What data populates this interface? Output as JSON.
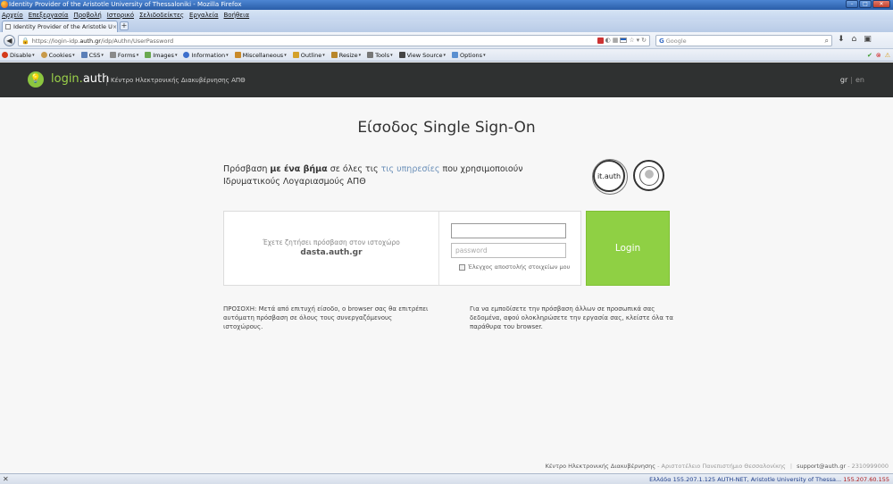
{
  "window": {
    "title": "Identity Provider of the Aristotle University of Thessaloniki - Mozilla Firefox",
    "controls": {
      "minimize": "–",
      "maximize": "□",
      "close": "✕"
    }
  },
  "menubar": {
    "items": [
      "Αρχείο",
      "Επεξεργασία",
      "Προβολή",
      "Ιστορικό",
      "Σελιδοδείκτες",
      "Εργαλεία",
      "Βοήθεια"
    ]
  },
  "tabs": [
    {
      "label": "Identity Provider of the Aristotle Universi...",
      "close": "×"
    }
  ],
  "newtab": "+",
  "navbar": {
    "url_prefix": "https://login-idp.",
    "url_domain": "auth.gr",
    "url_path": "/idp/Authn/UserPassword",
    "search_engine": "G",
    "search_placeholder": "Google"
  },
  "devtoolbar": {
    "items": [
      {
        "label": "Disable",
        "icon": "disable-icon",
        "color": "#d43a1a"
      },
      {
        "label": "Cookies",
        "icon": "cookie-icon",
        "color": "#c89a4a"
      },
      {
        "label": "CSS",
        "icon": "css-icon",
        "color": "#5b7fb8"
      },
      {
        "label": "Forms",
        "icon": "forms-icon",
        "color": "#8a8a8a"
      },
      {
        "label": "Images",
        "icon": "images-icon",
        "color": "#6aa84f"
      },
      {
        "label": "Information",
        "icon": "information-icon",
        "color": "#3d6fcc"
      },
      {
        "label": "Miscellaneous",
        "icon": "miscellaneous-icon",
        "color": "#c98a2a"
      },
      {
        "label": "Outline",
        "icon": "outline-icon",
        "color": "#d4a12a"
      },
      {
        "label": "Resize",
        "icon": "resize-icon",
        "color": "#b8862a"
      },
      {
        "label": "Tools",
        "icon": "tools-icon",
        "color": "#777777"
      },
      {
        "label": "View Source",
        "icon": "view-source-icon",
        "color": "#444444"
      },
      {
        "label": "Options",
        "icon": "options-icon",
        "color": "#5a8fd0"
      }
    ]
  },
  "header": {
    "brand_1": "login.",
    "brand_2": "auth",
    "subtitle": "Κέντρο Ηλεκτρονικής Διακυβέρνησης ΑΠΘ",
    "lang_gr": "gr",
    "lang_sep": "|",
    "lang_en": "en",
    "accent": "#8cc63f",
    "background": "#2f3131"
  },
  "main": {
    "title": "Είσοδος Single Sign-On",
    "intro_1": "Πρόσβαση ",
    "intro_bold": "με ένα βήμα",
    "intro_2": " σε όλες τις ",
    "intro_link": "τις υπηρεσίες",
    "intro_3": " που χρησιμοποιούν Ιδρυματικούς Λογαριασμούς ΑΠΘ",
    "badge_it": "it.auth",
    "request_text": "Έχετε ζητήσει πρόσβαση στον ιστοχώρο",
    "request_site": "dasta.auth.gr",
    "username_value": "",
    "password_placeholder": "password",
    "remember_label": "Έλεγχος αποστολής στοιχείων μου",
    "login_button": "Login",
    "login_color": "#8fd044",
    "note_left": "ΠΡΟΣΟΧΗ: Μετά από επιτυχή είσοδο, ο browser σας θα επιτρέπει αυτόματη πρόσβαση σε όλους τους συνεργαζόμενους ιστοχώρους.",
    "note_right": "Για να εμποδίσετε την πρόσβαση άλλων σε προσωπικά σας δεδομένα, αφού ολοκληρώσετε την εργασία σας, κλείστε όλα τα παράθυρα του browser."
  },
  "footer": {
    "org": "Κέντρο Ηλεκτρονικής Διακυβέρνησης",
    "univ": " - Αριστοτέλειο Πανεπιστήμιο Θεσσαλονίκης",
    "sep": "|",
    "email": "support@auth.gr",
    "phone": " - 2310999000"
  },
  "statusbar": {
    "close": "✕",
    "country": "Ελλάδα",
    "ip1": "155.207.1.125",
    "network": "AUTH-NET, Aristotle University of Thessa...",
    "ip2": "155.207.60.155"
  }
}
